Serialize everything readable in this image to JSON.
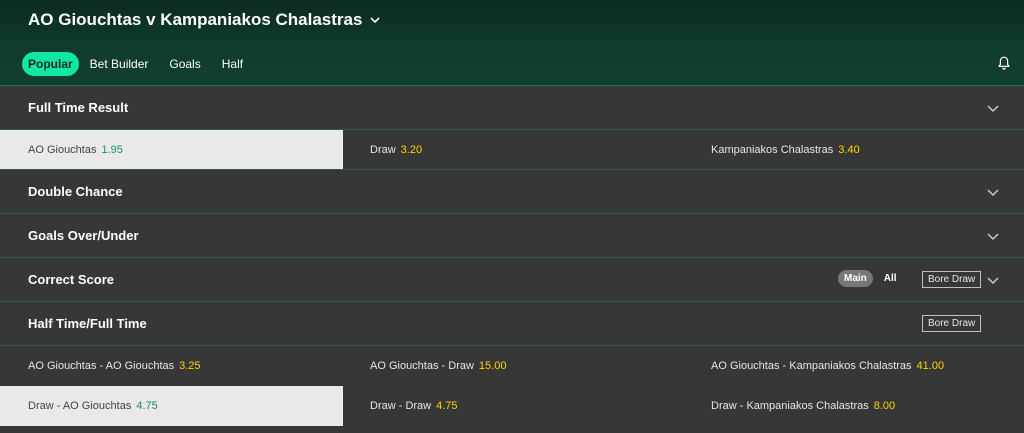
{
  "match": {
    "title": "AO Giouchtas v Kampaniakos Chalastras",
    "tabs": [
      {
        "label": "Popular",
        "active": true
      },
      {
        "label": "Bet Builder",
        "active": false
      },
      {
        "label": "Goals",
        "active": false
      },
      {
        "label": "Half",
        "active": false
      }
    ]
  },
  "markets": {
    "full_time_result": {
      "title": "Full Time Result",
      "selections": [
        {
          "label": "AO Giouchtas",
          "price": "1.95",
          "selected": true
        },
        {
          "label": "Draw",
          "price": "3.20",
          "selected": false
        },
        {
          "label": "Kampaniakos Chalastras",
          "price": "3.40",
          "selected": false
        }
      ]
    },
    "double_chance": {
      "title": "Double Chance"
    },
    "goals_over_under": {
      "title": "Goals Over/Under"
    },
    "correct_score": {
      "title": "Correct Score",
      "toggle": {
        "main": "Main",
        "all": "All"
      },
      "bore_draw": "Bore Draw"
    },
    "half_time_full_time": {
      "title": "Half Time/Full Time",
      "bore_draw": "Bore Draw",
      "rows": [
        [
          {
            "label": "AO Giouchtas - AO Giouchtas",
            "price": "3.25",
            "selected": false
          },
          {
            "label": "AO Giouchtas - Draw",
            "price": "15.00",
            "selected": false
          },
          {
            "label": "AO Giouchtas - Kampaniakos Chalastras",
            "price": "41.00",
            "selected": false
          }
        ],
        [
          {
            "label": "Draw - AO Giouchtas",
            "price": "4.75",
            "selected": true
          },
          {
            "label": "Draw - Draw",
            "price": "4.75",
            "selected": false
          },
          {
            "label": "Draw - Kampaniakos Chalastras",
            "price": "8.00",
            "selected": false
          }
        ]
      ]
    }
  },
  "colors": {
    "accent": "#11e7a3",
    "price": "#ffd400",
    "selected_price": "#1f8a60",
    "background": "#373737"
  },
  "icons": {
    "title_dropdown": "chevron-down-icon",
    "notifications": "bell-icon",
    "market_toggle": "chevron-down-icon"
  }
}
